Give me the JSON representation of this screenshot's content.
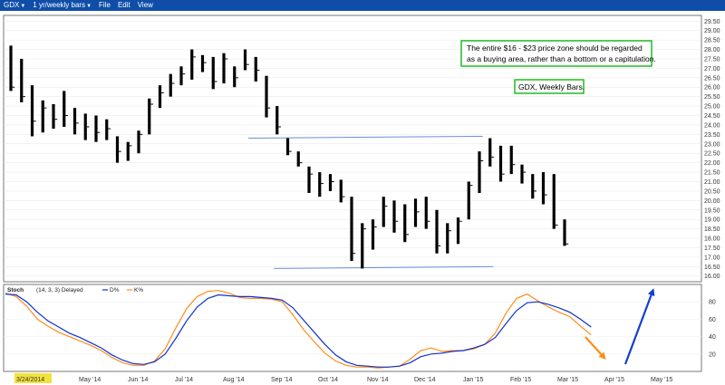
{
  "toolbar": {
    "symbol": "GDX",
    "period": "1 yr/weekly bars",
    "menu": [
      "File",
      "Edit",
      "View"
    ]
  },
  "colors": {
    "price_bar": "#000000",
    "trendline": "#6a8ed6",
    "d_line": "#1030d0",
    "k_line": "#ff8c1a",
    "up_arrow": "#1040d0",
    "down_arrow": "#ff8c1a",
    "note_border": "#22bb22",
    "x_highlight": "#f2e33a"
  },
  "chart_data": [
    {
      "type": "ohlc",
      "title": "GDX, Weekly Bars.",
      "annotation": "The entire $16 - $23 price zone should be regarded as a buying area, rather than a bottom or a capitulation.",
      "annotation_lines": [
        "The entire $16 - $23 price zone should be regarded",
        "as a buying area, rather than a bottom or a capitulation."
      ],
      "y_ticks": [
        "29.50",
        "29.00",
        "28.50",
        "28.00",
        "27.50",
        "27.00",
        "26.50",
        "26.00",
        "25.50",
        "25.00",
        "24.50",
        "24.00",
        "23.50",
        "23.00",
        "22.50",
        "22.00",
        "21.50",
        "21.00",
        "20.50",
        "20.00",
        "19.50",
        "19.00",
        "18.50",
        "18.00",
        "17.50",
        "17.00",
        "16.50",
        "16.00"
      ],
      "ylim": [
        15.7,
        29.8
      ],
      "x_labels": [
        "3/24/2014",
        "May '14",
        "Jun '14",
        "Jul '14",
        "Aug '14",
        "Sep '14",
        "Oct '14",
        "Nov '14",
        "Dec '14",
        "Jan '15",
        "Feb '15",
        "Mar '15",
        "Apr '15",
        "May '15"
      ],
      "bars": [
        {
          "h": 28.2,
          "l": 25.8,
          "c": 26.0
        },
        {
          "h": 27.5,
          "l": 25.2,
          "c": 25.5
        },
        {
          "h": 26.1,
          "l": 23.4,
          "c": 24.2
        },
        {
          "h": 25.3,
          "l": 23.6,
          "c": 24.9
        },
        {
          "h": 25.1,
          "l": 23.8,
          "c": 24.3
        },
        {
          "h": 25.8,
          "l": 23.9,
          "c": 24.5
        },
        {
          "h": 24.9,
          "l": 23.5,
          "c": 24.1
        },
        {
          "h": 24.6,
          "l": 23.2,
          "c": 23.9
        },
        {
          "h": 24.5,
          "l": 23.1,
          "c": 23.6
        },
        {
          "h": 24.3,
          "l": 23.2,
          "c": 23.8
        },
        {
          "h": 23.4,
          "l": 22.0,
          "c": 22.6
        },
        {
          "h": 23.1,
          "l": 22.1,
          "c": 22.9
        },
        {
          "h": 23.7,
          "l": 22.5,
          "c": 23.5
        },
        {
          "h": 25.4,
          "l": 23.5,
          "c": 25.1
        },
        {
          "h": 26.1,
          "l": 24.9,
          "c": 25.7
        },
        {
          "h": 26.7,
          "l": 25.5,
          "c": 26.2
        },
        {
          "h": 27.1,
          "l": 26.1,
          "c": 26.7
        },
        {
          "h": 28.0,
          "l": 26.4,
          "c": 27.6
        },
        {
          "h": 27.7,
          "l": 26.8,
          "c": 27.3
        },
        {
          "h": 27.6,
          "l": 25.9,
          "c": 26.3
        },
        {
          "h": 27.8,
          "l": 26.2,
          "c": 27.5
        },
        {
          "h": 27.1,
          "l": 26.0,
          "c": 26.5
        },
        {
          "h": 28.0,
          "l": 26.9,
          "c": 27.2
        },
        {
          "h": 27.6,
          "l": 26.3,
          "c": 26.9
        },
        {
          "h": 26.6,
          "l": 24.4,
          "c": 24.9
        },
        {
          "h": 25.0,
          "l": 23.5,
          "c": 23.9
        },
        {
          "h": 23.3,
          "l": 22.4,
          "c": 22.6
        },
        {
          "h": 22.6,
          "l": 21.8,
          "c": 22.0
        },
        {
          "h": 21.8,
          "l": 20.4,
          "c": 21.4
        },
        {
          "h": 21.5,
          "l": 20.2,
          "c": 20.9
        },
        {
          "h": 21.4,
          "l": 20.5,
          "c": 21.0
        },
        {
          "h": 21.1,
          "l": 19.9,
          "c": 20.2
        },
        {
          "h": 20.2,
          "l": 16.8,
          "c": 17.2
        },
        {
          "h": 18.8,
          "l": 16.4,
          "c": 18.5
        },
        {
          "h": 19.0,
          "l": 17.4,
          "c": 18.6
        },
        {
          "h": 20.2,
          "l": 18.6,
          "c": 19.7
        },
        {
          "h": 20.0,
          "l": 18.3,
          "c": 18.9
        },
        {
          "h": 19.8,
          "l": 17.8,
          "c": 18.2
        },
        {
          "h": 20.1,
          "l": 18.6,
          "c": 19.4
        },
        {
          "h": 20.2,
          "l": 18.5,
          "c": 18.9
        },
        {
          "h": 19.5,
          "l": 17.2,
          "c": 17.6
        },
        {
          "h": 18.8,
          "l": 17.2,
          "c": 18.4
        },
        {
          "h": 19.1,
          "l": 17.7,
          "c": 18.9
        },
        {
          "h": 21.0,
          "l": 19.0,
          "c": 20.8
        },
        {
          "h": 22.6,
          "l": 20.4,
          "c": 22.1
        },
        {
          "h": 23.3,
          "l": 21.8,
          "c": 22.3
        },
        {
          "h": 22.9,
          "l": 21.0,
          "c": 21.4
        },
        {
          "h": 22.9,
          "l": 21.4,
          "c": 21.9
        },
        {
          "h": 21.9,
          "l": 20.9,
          "c": 21.5
        },
        {
          "h": 21.4,
          "l": 20.1,
          "c": 20.5
        },
        {
          "h": 21.5,
          "l": 19.8,
          "c": 20.3
        },
        {
          "h": 21.4,
          "l": 18.5,
          "c": 18.7
        },
        {
          "h": 19.0,
          "l": 17.6,
          "c": 17.7
        }
      ],
      "trendlines": [
        {
          "from": [
            22.3,
            23.3
          ],
          "to": [
            44.3,
            23.4
          ]
        },
        {
          "from": [
            24.7,
            16.4
          ],
          "to": [
            45.3,
            16.5
          ]
        }
      ]
    },
    {
      "type": "line",
      "indicator": "Stoch",
      "params": "(14, 3, 3) Delayed",
      "legend": [
        "D%",
        "K%"
      ],
      "y_ticks": [
        "80",
        "60",
        "40",
        "20"
      ],
      "ylim": [
        0,
        100
      ],
      "series": [
        {
          "name": "D%",
          "values": [
            89,
            88,
            80,
            68,
            58,
            51,
            44,
            39,
            33,
            27,
            19,
            13,
            9,
            8,
            11,
            20,
            38,
            58,
            74,
            84,
            88,
            87,
            86,
            86,
            85,
            84,
            82,
            73,
            59,
            45,
            31,
            19,
            11,
            7,
            6,
            5,
            5,
            6,
            10,
            17,
            20,
            21,
            23,
            24,
            27,
            31,
            39,
            55,
            70,
            79,
            80,
            77,
            73,
            68,
            60,
            51
          ]
        },
        {
          "name": "K%",
          "values": [
            90,
            86,
            75,
            60,
            52,
            45,
            40,
            35,
            30,
            24,
            16,
            10,
            7,
            7,
            12,
            26,
            50,
            72,
            86,
            92,
            93,
            90,
            85,
            84,
            84,
            83,
            80,
            65,
            48,
            34,
            21,
            12,
            7,
            5,
            5,
            4,
            5,
            6,
            14,
            24,
            27,
            23,
            24,
            24,
            26,
            31,
            44,
            67,
            84,
            89,
            81,
            74,
            68,
            63,
            52,
            42
          ]
        }
      ]
    }
  ]
}
